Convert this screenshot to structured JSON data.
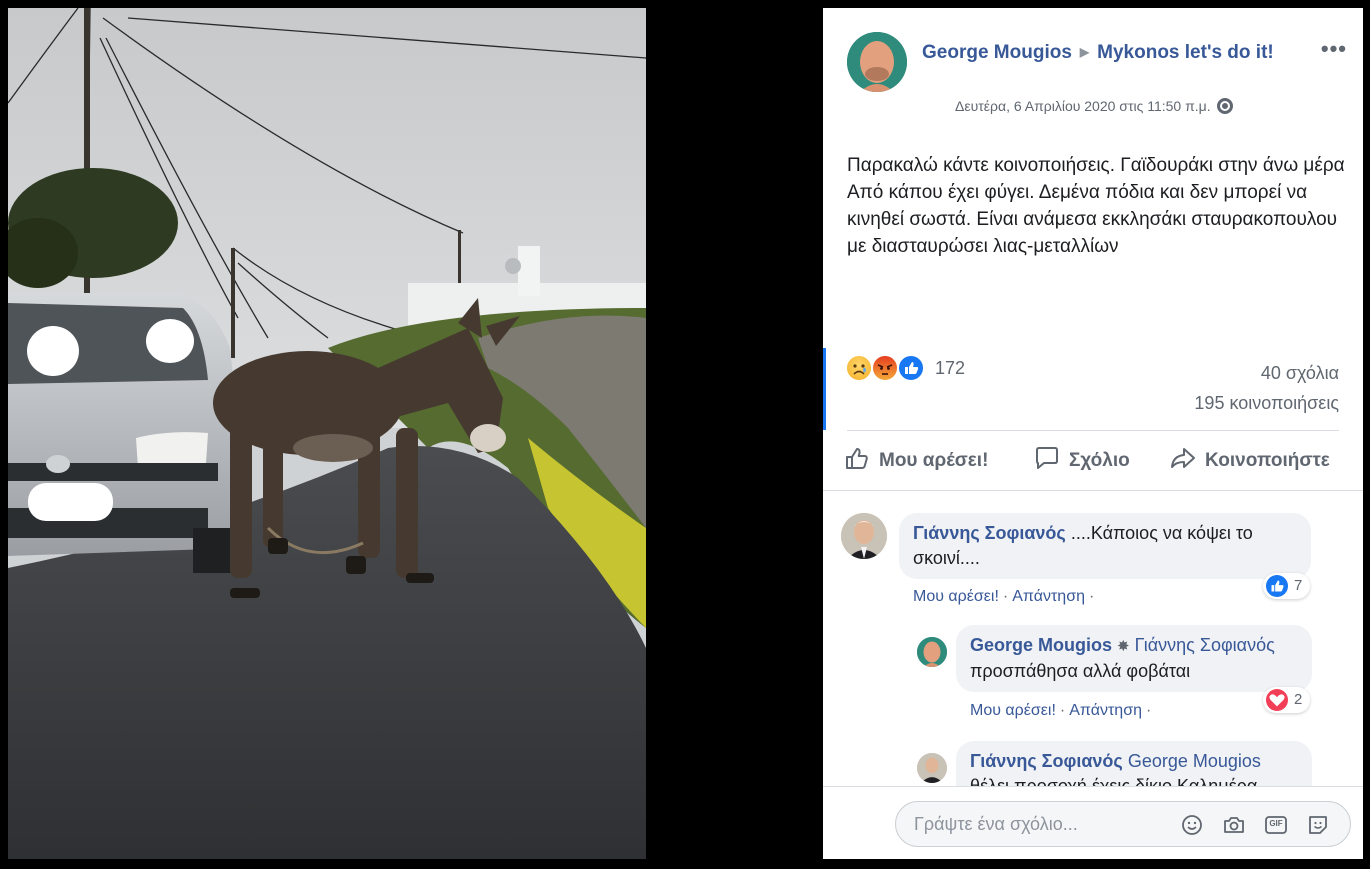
{
  "post": {
    "author": "George Mougios",
    "group": "Mykonos let's do it!",
    "more": "•••",
    "date": "Δευτέρα, 6 Απριλίου 2020 στις 11:50 π.μ.",
    "text": "Παρακαλώ κάντε κοινοποιήσεις. Γαϊδουράκι στην άνω μέρα Από κάπου έχει φύγει. Δεμένα πόδια και δεν μπορεί να κινηθεί σωστά. Είναι ανάμεσα εκκλησάκι σταυρακοπουλου με διασταυρώσει λιας-μεταλλίων",
    "reaction_icons": [
      "sad-reaction-icon",
      "angry-reaction-icon",
      "like-reaction-icon"
    ],
    "reaction_count": "172",
    "comments_count": "40 σχόλια",
    "shares_count": "195 κοινοποιήσεις"
  },
  "actions": {
    "like": "Μου αρέσει!",
    "comment": "Σχόλιο",
    "share": "Κοινοποιήστε"
  },
  "comments": [
    {
      "author": "Γιάννης Σοφιανός",
      "text": "....Κάποιος να κόψει το σκοινί....",
      "like": "Μου αρέσει!",
      "reply": "Απάντηση",
      "reaction": "like",
      "reaction_count": "7"
    },
    {
      "author": "George Mougios",
      "mention": "Γιάννης Σοφιανός",
      "text": "προσπάθησα αλλά φοβάται",
      "like": "Μου αρέσει!",
      "reply": "Απάντηση",
      "reaction": "love",
      "reaction_count": "2"
    },
    {
      "author": "Γιάννης Σοφιανός",
      "mention": "George Mougios",
      "text": "θέλει προσοχή.έχεις δίκιο.Καλημέρα."
    }
  ],
  "composer": {
    "placeholder": "Γράψτε ένα σχόλιο...",
    "tools": [
      "emoji-icon",
      "camera-icon",
      "gif-icon",
      "sticker-icon"
    ],
    "gif_label": "GIF"
  },
  "colors": {
    "link": "#385898",
    "accent": "#1877f2",
    "love": "#f33e58"
  }
}
